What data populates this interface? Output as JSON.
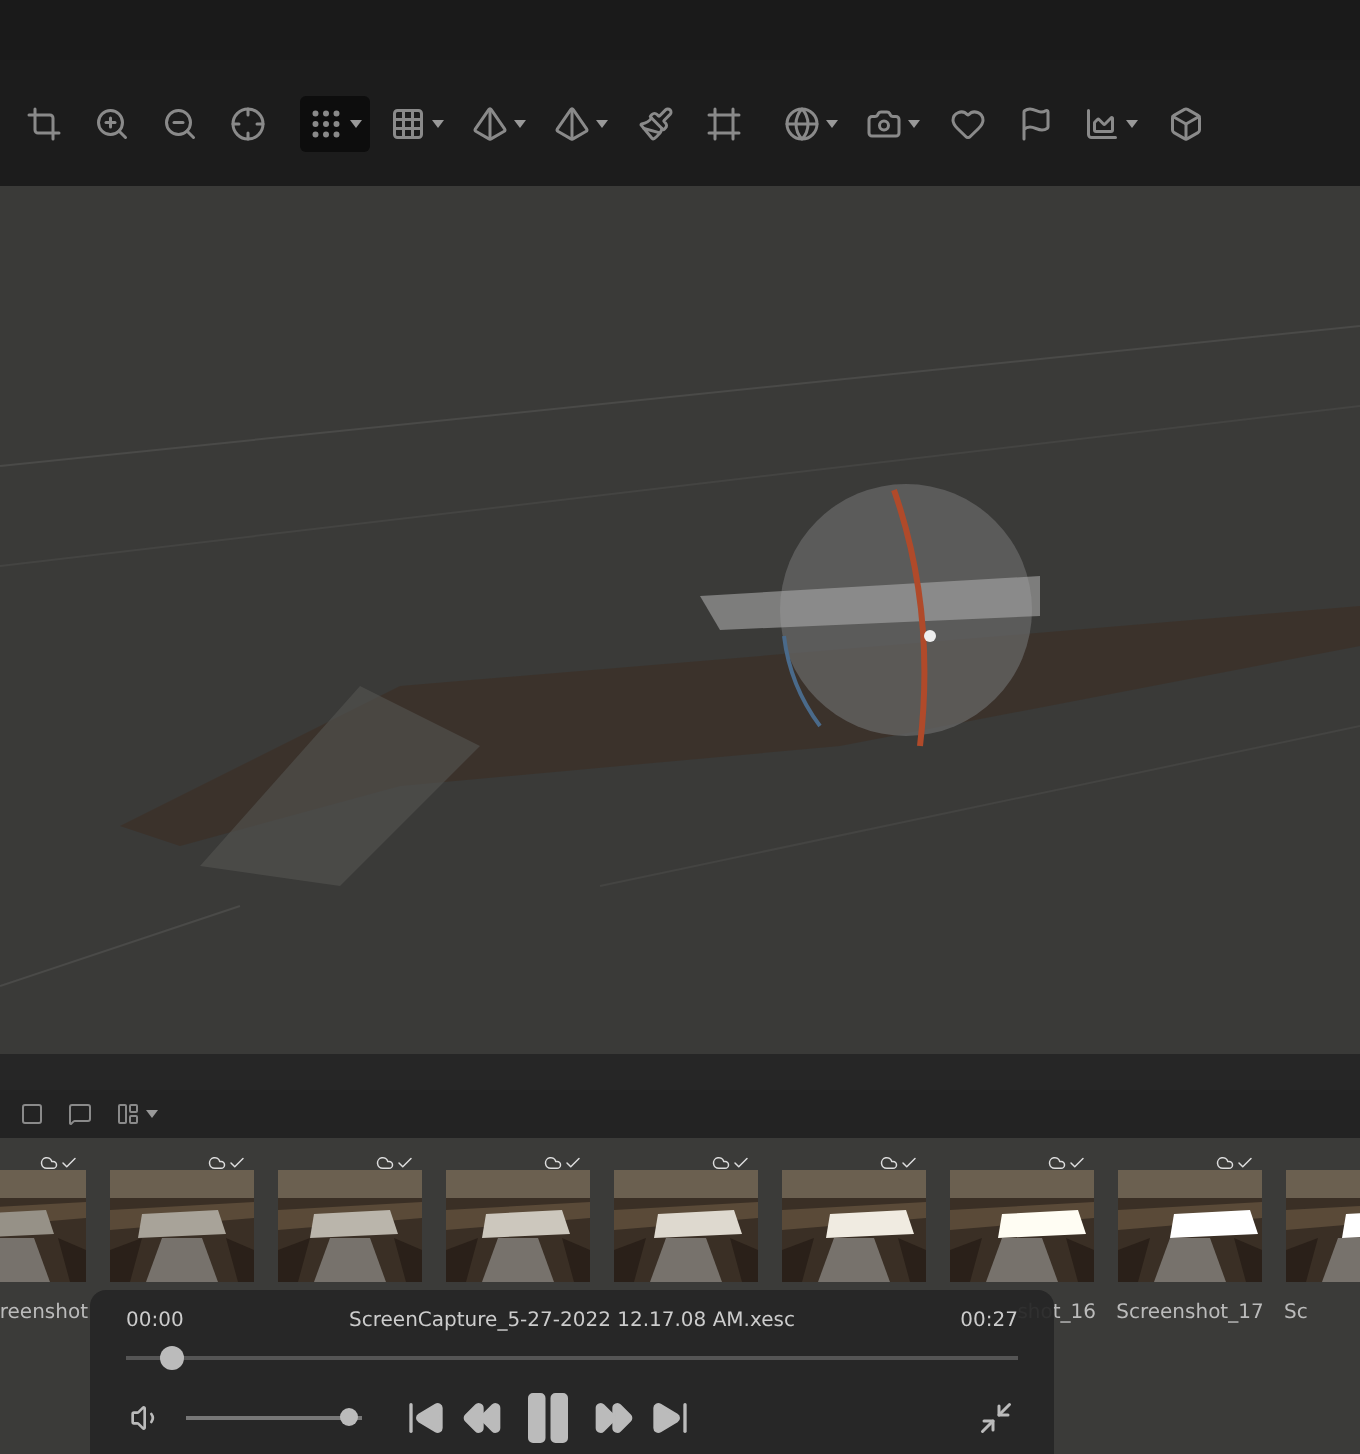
{
  "toolbar": [
    {
      "kind": "crop",
      "has_menu": false,
      "selected": false
    },
    {
      "kind": "zoom-in",
      "has_menu": false,
      "selected": false
    },
    {
      "kind": "zoom-out",
      "has_menu": false,
      "selected": false
    },
    {
      "kind": "target",
      "has_menu": false,
      "selected": false
    },
    {
      "kind": "points",
      "has_menu": true,
      "selected": true
    },
    {
      "kind": "grid",
      "has_menu": true,
      "selected": false
    },
    {
      "kind": "pyramid",
      "has_menu": true,
      "selected": false
    },
    {
      "kind": "pyramid",
      "has_menu": true,
      "selected": false
    },
    {
      "kind": "brush",
      "has_menu": false,
      "selected": false
    },
    {
      "kind": "frame",
      "has_menu": false,
      "selected": false
    },
    {
      "kind": "globe",
      "has_menu": true,
      "selected": false
    },
    {
      "kind": "camera",
      "has_menu": true,
      "selected": false
    },
    {
      "kind": "heart",
      "has_menu": false,
      "selected": false
    },
    {
      "kind": "flag",
      "has_menu": false,
      "selected": false
    },
    {
      "kind": "chart",
      "has_menu": true,
      "selected": false
    },
    {
      "kind": "box",
      "has_menu": false,
      "selected": false
    }
  ],
  "photos_toolbar": [
    {
      "kind": "square",
      "has_menu": false
    },
    {
      "kind": "chat",
      "has_menu": false
    },
    {
      "kind": "layout",
      "has_menu": true
    }
  ],
  "thumbnails": [
    {
      "kind": "picture",
      "label": "reenshot"
    },
    {
      "kind": "picture"
    },
    {
      "kind": "picture"
    },
    {
      "kind": "picture"
    },
    {
      "kind": "picture"
    },
    {
      "kind": "picture"
    },
    {
      "kind": "picture",
      "label": "shot_16"
    },
    {
      "kind": "picture",
      "label": "Screenshot_17"
    },
    {
      "kind": "picture",
      "label": "Sc"
    }
  ],
  "player": {
    "start": "00:00",
    "title": "ScreenCapture_5-27-2022 12.17.08 AM.xesc",
    "end": "00:27",
    "level": 0.04,
    "volume": {
      "level": 0.97
    },
    "playing": true
  }
}
